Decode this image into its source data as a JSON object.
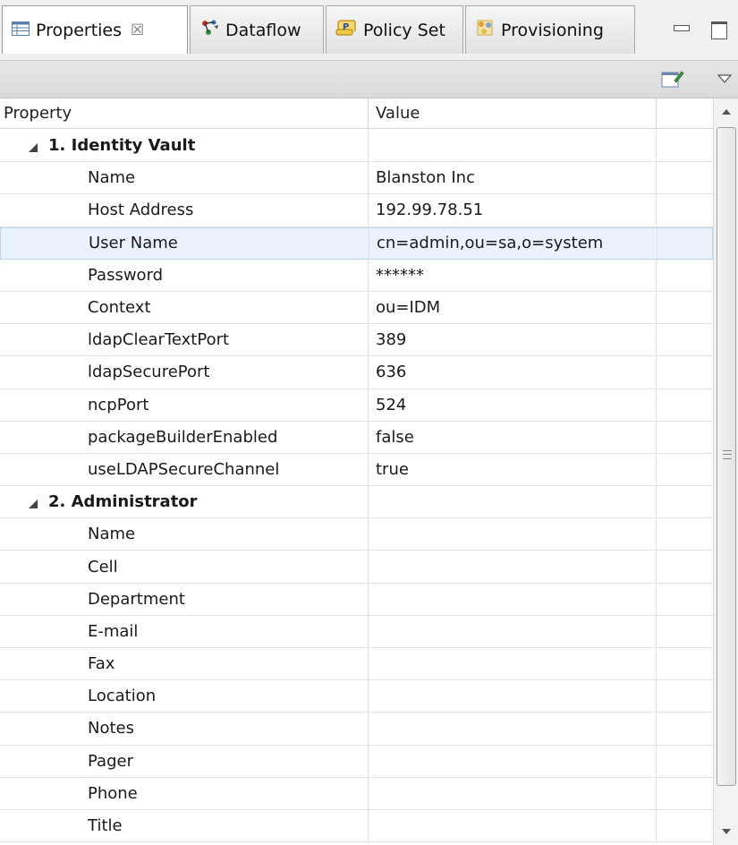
{
  "tabs": [
    {
      "label": "Properties",
      "icon": "properties-table-icon",
      "active": true,
      "close_glyph": "☒"
    },
    {
      "label": "Dataflow",
      "icon": "dataflow-icon",
      "active": false
    },
    {
      "label": "Policy Set",
      "icon": "policy-set-icon",
      "active": false
    },
    {
      "label": "Provisioning",
      "icon": "provisioning-icon",
      "active": false
    }
  ],
  "columns": {
    "property": "Property",
    "value": "Value"
  },
  "groups": [
    {
      "label": "1. Identity Vault",
      "rows": [
        {
          "property": "Name",
          "value": "Blanston Inc"
        },
        {
          "property": "Host Address",
          "value": "192.99.78.51"
        },
        {
          "property": "User Name",
          "value": "cn=admin,ou=sa,o=system",
          "selected": true
        },
        {
          "property": "Password",
          "value": "******"
        },
        {
          "property": "Context",
          "value": "ou=IDM"
        },
        {
          "property": "ldapClearTextPort",
          "value": "389"
        },
        {
          "property": "ldapSecurePort",
          "value": "636"
        },
        {
          "property": "ncpPort",
          "value": "524"
        },
        {
          "property": "packageBuilderEnabled",
          "value": "false"
        },
        {
          "property": "useLDAPSecureChannel",
          "value": "true"
        }
      ]
    },
    {
      "label": "2. Administrator",
      "rows": [
        {
          "property": "Name",
          "value": ""
        },
        {
          "property": "Cell",
          "value": ""
        },
        {
          "property": "Department",
          "value": ""
        },
        {
          "property": "E-mail",
          "value": ""
        },
        {
          "property": "Fax",
          "value": ""
        },
        {
          "property": "Location",
          "value": ""
        },
        {
          "property": "Notes",
          "value": ""
        },
        {
          "property": "Pager",
          "value": ""
        },
        {
          "property": "Phone",
          "value": ""
        },
        {
          "property": "Title",
          "value": ""
        }
      ]
    }
  ],
  "colors": {
    "selection_bg": "#eaf3fb",
    "selection_border": "#b9d5ec",
    "grid_line": "#e3e3e3"
  }
}
